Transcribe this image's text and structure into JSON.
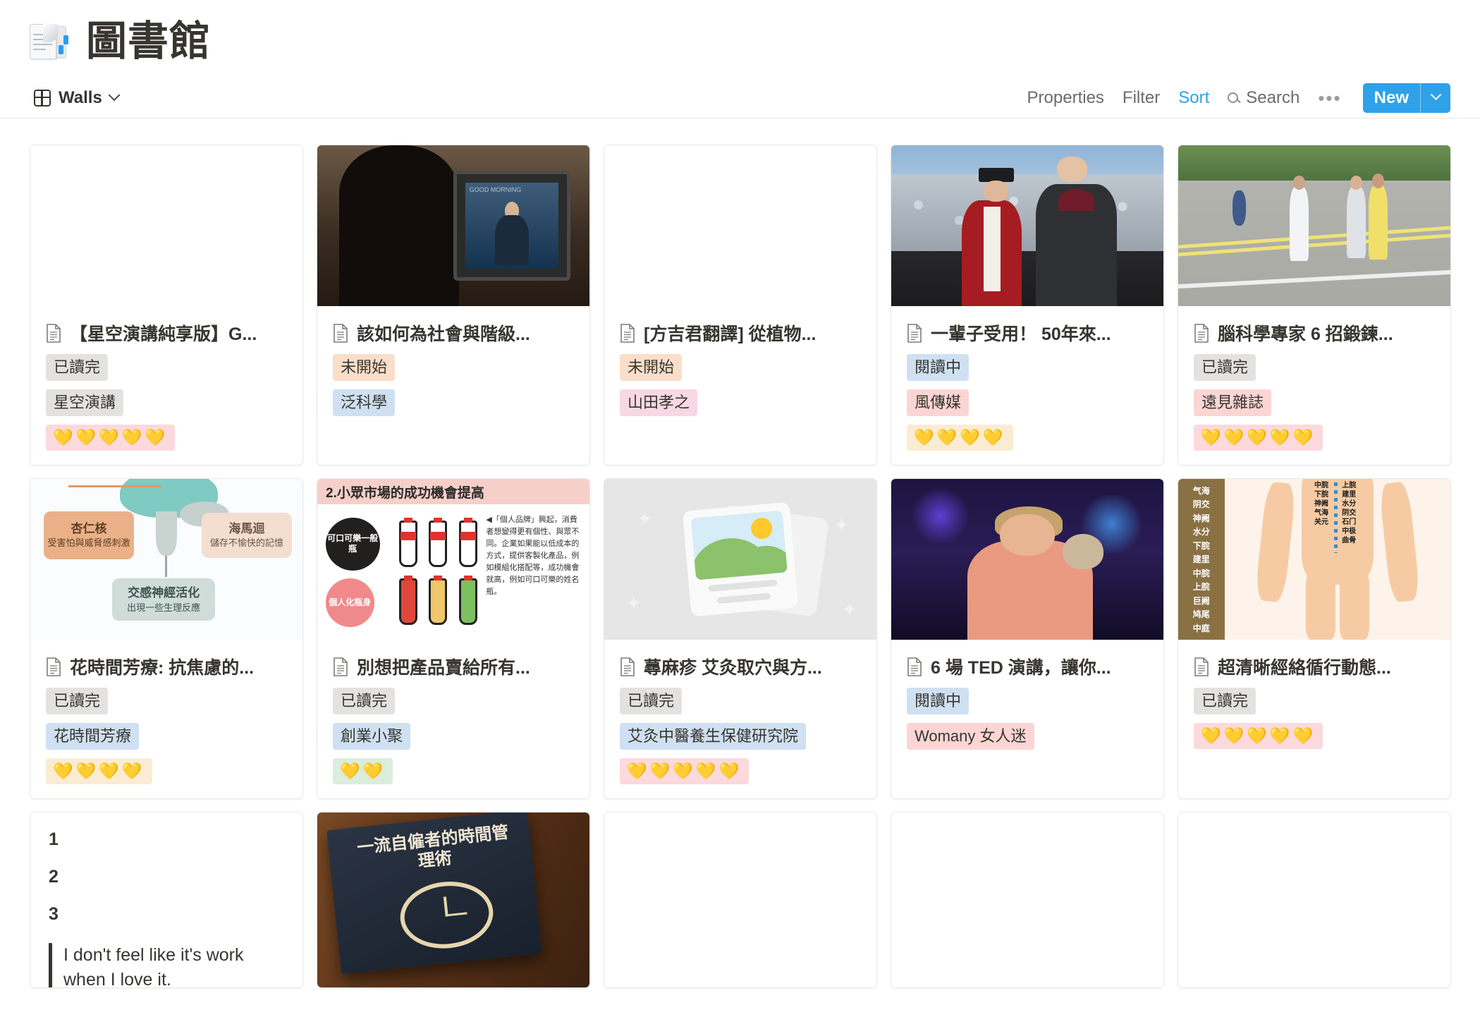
{
  "header": {
    "emoji_name": "page-stack-emoji",
    "title": "圖書館"
  },
  "viewbar": {
    "view_name": "Walls",
    "view_icon": "gallery-grid-icon",
    "properties_label": "Properties",
    "filter_label": "Filter",
    "sort_label": "Sort",
    "search_label": "Search",
    "more_label": "•••",
    "new_label": "New",
    "accent_color": "#2ea1e8"
  },
  "cards": [
    {
      "title": "【星空演講純享版】G...",
      "cover": "tv",
      "status": {
        "label": "已讀完",
        "color": "gray"
      },
      "source": {
        "label": "星空演講",
        "color": "gray"
      },
      "rating": {
        "hearts": "💛💛💛💛💛",
        "bg": "pinkbg"
      }
    },
    {
      "title": "該如何為社會與階級...",
      "cover": "tv-scene",
      "status": {
        "label": "未開始",
        "color": "orange"
      },
      "source": {
        "label": "泛科學",
        "color": "blue"
      },
      "rating": null
    },
    {
      "title": "[方吉君翻譯] 從植物...",
      "cover": "blank",
      "status": {
        "label": "未開始",
        "color": "orange"
      },
      "source": {
        "label": "山田孝之",
        "color": "pink"
      },
      "rating": null
    },
    {
      "title": "一輩子受用！ 50年來...",
      "cover": "graduation",
      "status": {
        "label": "閱讀中",
        "color": "blue"
      },
      "source": {
        "label": "風傳媒",
        "color": "red"
      },
      "rating": {
        "hearts": "💛💛💛💛",
        "bg": "creambg"
      }
    },
    {
      "title": "腦科學專家 6 招鍛鍊...",
      "cover": "road",
      "status": {
        "label": "已讀完",
        "color": "gray"
      },
      "source": {
        "label": "遠見雜誌",
        "color": "red"
      },
      "rating": {
        "hearts": "💛💛💛💛💛",
        "bg": "pinkbg"
      }
    },
    {
      "title": "花時間芳療: 抗焦慮的...",
      "cover": "brain-infographic",
      "status": {
        "label": "已讀完",
        "color": "gray"
      },
      "source": {
        "label": "花時間芳療",
        "color": "blue"
      },
      "rating": {
        "hearts": "💛💛💛💛",
        "bg": "creambg"
      }
    },
    {
      "title": "別想把產品賣給所有...",
      "cover": "market-infographic",
      "status": {
        "label": "已讀完",
        "color": "gray"
      },
      "source": {
        "label": "創業小聚",
        "color": "blue"
      },
      "rating": {
        "hearts": "💛💛",
        "bg": "greenbg"
      }
    },
    {
      "title": "蕁麻疹 艾灸取穴與方...",
      "cover": "image-placeholder",
      "status": {
        "label": "已讀完",
        "color": "gray"
      },
      "source": {
        "label": "艾灸中醫養生保健研究院",
        "color": "blue"
      },
      "rating": {
        "hearts": "💛💛💛💛💛",
        "bg": "pinkbg"
      }
    },
    {
      "title": "6 場 TED 演講，讓你...",
      "cover": "ted-talk",
      "status": {
        "label": "閱讀中",
        "color": "blue"
      },
      "source": {
        "label": "Womany 女人迷",
        "color": "red"
      },
      "rating": null
    },
    {
      "title": "超清晰經絡循行動態...",
      "cover": "meridian-chart",
      "status": {
        "label": "已讀完",
        "color": "gray"
      },
      "source": null,
      "rating": {
        "hearts": "💛💛💛💛💛",
        "bg": "pinkbg"
      }
    }
  ],
  "row3": {
    "preview_card": {
      "list_items": [
        "1",
        "2",
        "3"
      ],
      "quote": "I don't feel like it's work when I love it."
    },
    "book_card": {
      "cover_title": "一流自僱者的時間管理術"
    }
  },
  "cover_text": {
    "market": {
      "headline": "2.小眾市場的成功機會提高",
      "circle_dark": "可口可樂一般瓶",
      "circle_rose": "個人化瓶身",
      "paragraph": "◀「個人品牌」興起，消費者想變得更有個性、與眾不同。企業如果能以低成本的方式，提供客製化產品，例如模組化搭配等，成功機會就高，例如可口可樂的姓名瓶。"
    },
    "brain": {
      "amygdala_title": "杏仁核",
      "amygdala_sub": "受害怕與威脅感刺激",
      "hippocampus_title": "海馬迴",
      "hippocampus_sub": "儲存不愉快的記憶",
      "sympathetic_title": "交感神經活化",
      "sympathetic_sub": "出現一些生理反應"
    },
    "meridian": {
      "side_points": "气海 阴交 神阙 水分 下脘 建里 中脘 上脘 巨阙 鸠尾 中庭",
      "left_labels": "中脘 下脘 神阙 气海 关元",
      "right_labels": "上脘 建里 水分 阴交 石门 中极 曲骨"
    }
  }
}
